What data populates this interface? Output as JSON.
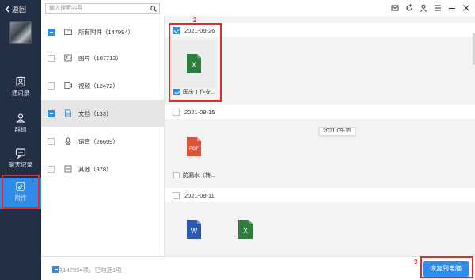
{
  "back_label": "返回",
  "nav": [
    {
      "label": "通讯录",
      "icon": "contacts-icon"
    },
    {
      "label": "群组",
      "icon": "group-icon"
    },
    {
      "label": "聊天记录",
      "icon": "chat-icon"
    },
    {
      "label": "附件",
      "icon": "attachment-icon"
    }
  ],
  "search": {
    "placeholder": "输入搜索内容"
  },
  "categories": [
    {
      "label": "所有附件（147994）",
      "icon": "folder-icon",
      "check": "partial"
    },
    {
      "label": "图片（107712）",
      "icon": "image-icon",
      "check": "none"
    },
    {
      "label": "视频（12472）",
      "icon": "video-icon",
      "check": "none"
    },
    {
      "label": "文档（133）",
      "icon": "document-icon",
      "check": "partial"
    },
    {
      "label": "语音（26699）",
      "icon": "microphone-icon",
      "check": "none"
    },
    {
      "label": "其他（978）",
      "icon": "other-icon",
      "check": "none"
    }
  ],
  "groups": [
    {
      "date": "2021-09-26",
      "files": [
        {
          "name": "国庆工作安...",
          "type": "X",
          "color": "#2e7d3c"
        }
      ]
    },
    {
      "date": "2021-09-15",
      "files": [
        {
          "name": "防漏水（转...",
          "type": "PDF",
          "color": "#e0533a"
        }
      ]
    },
    {
      "date": "2021-09-11",
      "files": [
        {
          "name": "",
          "type": "W",
          "color": "#2a5bb0"
        },
        {
          "name": "",
          "type": "X",
          "color": "#2e7d3c"
        }
      ]
    }
  ],
  "tooltip_date": "2021-09-15",
  "annotations": [
    "1",
    "2",
    "3"
  ],
  "bottom": {
    "summary": "共147994项，已勾选1项",
    "restore_label": "恢复到电脑"
  },
  "colors": {
    "sidebar": "#232f44",
    "accent": "#2f8ce8",
    "highlight": "#e42a2a"
  }
}
